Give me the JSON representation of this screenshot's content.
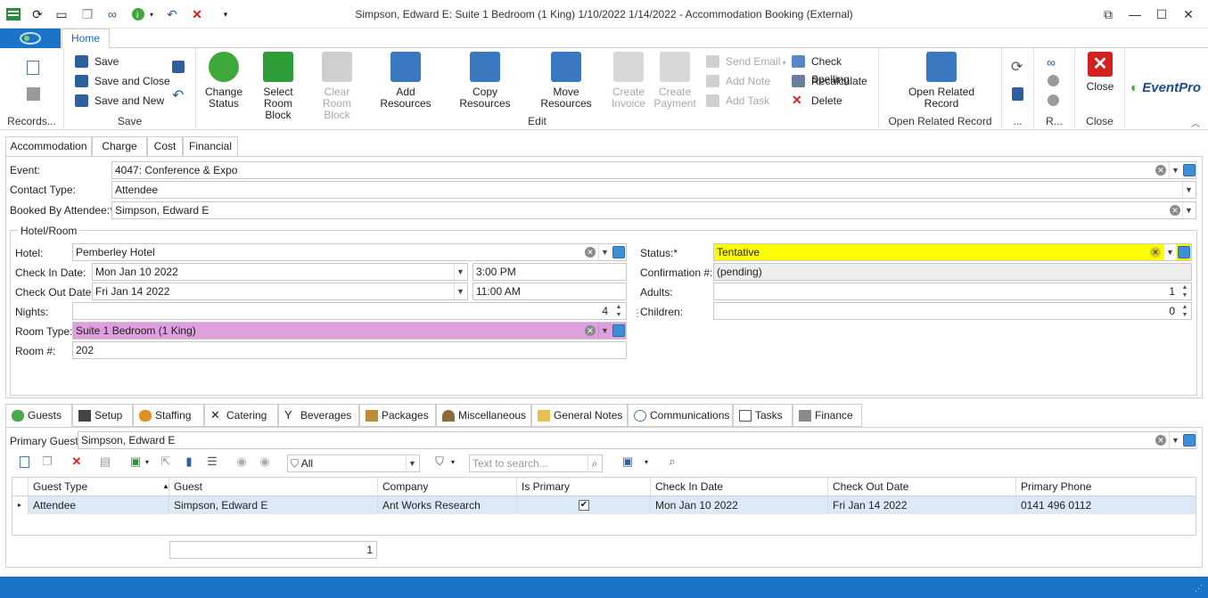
{
  "window": {
    "title": "Simpson, Edward E: Suite 1 Bedroom (1 King) 1/10/2022 1/14/2022  - Accommodation Booking (External)",
    "controls": {
      "restore": "⧉",
      "minimize": "—",
      "maximize": "☐",
      "close": "✕"
    }
  },
  "ribbon": {
    "home_tab": "Home",
    "groups": {
      "records": "Records...",
      "save": "Save",
      "edit": "Edit",
      "open_related": "Open Related Record",
      "more": "...",
      "r": "R...",
      "close": "Close"
    },
    "save": {
      "save": "Save",
      "save_close": "Save and Close",
      "save_new": "Save and New"
    },
    "edit": {
      "change_status": "Change Status",
      "select_room_block": "Select Room Block",
      "clear_room_block": "Clear Room Block",
      "add_resources": "Add Resources",
      "copy_resources": "Copy Resources",
      "move_resources": "Move Resources",
      "create_invoice": "Create Invoice",
      "create_payment": "Create Payment",
      "send_email": "Send Email",
      "add_note": "Add Note",
      "add_task": "Add Task",
      "check_spelling": "Check Spelling",
      "recalculate": "Recalculate",
      "delete": "Delete"
    },
    "open_related_record": "Open Related Record",
    "close_button": "Close",
    "brand": "EventPro"
  },
  "form_tabs": [
    "Accommodation",
    "Charge",
    "Cost",
    "Financial"
  ],
  "form": {
    "event_label": "Event:",
    "event_value": "4047: Conference & Expo",
    "contact_type_label": "Contact Type:",
    "contact_type_value": "Attendee",
    "booked_by_label": "Booked By Attendee:*",
    "booked_by_value": "Simpson, Edward E",
    "section_label": "Hotel/Room",
    "hotel_label": "Hotel:",
    "hotel_value": "Pemberley Hotel",
    "check_in_label": "Check In Date:",
    "check_in_date": "Mon Jan 10 2022",
    "check_in_time": "3:00 PM",
    "check_out_label": "Check Out Date:",
    "check_out_date": "Fri Jan 14 2022",
    "check_out_time": "11:00 AM",
    "nights_label": "Nights:",
    "nights_value": "4",
    "room_type_label": "Room Type:",
    "room_type_value": "Suite 1 Bedroom (1 King)",
    "room_no_label": "Room #:",
    "room_no_value": "202",
    "status_label": "Status:*",
    "status_value": "Tentative",
    "confirmation_label": "Confirmation #:",
    "confirmation_value": "(pending)",
    "adults_label": "Adults:",
    "adults_value": "1",
    "children_label": "Children:",
    "children_value": "0"
  },
  "bottom_tabs": [
    "Guests",
    "Setup",
    "Staffing",
    "Catering",
    "Beverages",
    "Packages",
    "Miscellaneous",
    "General Notes",
    "Communications",
    "Tasks",
    "Finance"
  ],
  "guests": {
    "primary_guest_label": "Primary Guest:",
    "primary_guest_value": "Simpson, Edward E",
    "filter_value": "All",
    "search_placeholder": "Text to search...",
    "columns": [
      "Guest Type",
      "Guest",
      "Company",
      "Is Primary",
      "Check In Date",
      "Check Out Date",
      "Primary Phone"
    ],
    "rows": [
      {
        "guest_type": "Attendee",
        "guest": "Simpson, Edward E",
        "company": "Ant Works Research",
        "is_primary": "✔",
        "check_in": "Mon Jan 10 2022",
        "check_out": "Fri Jan 14 2022",
        "phone": "0141 496 0112"
      }
    ],
    "footer_count": "1"
  },
  "colors": {
    "accent": "#1b73c7",
    "status_bg": "#ffff00",
    "room_type_bg": "#dda0dd",
    "row_selected": "#dceaf7"
  }
}
